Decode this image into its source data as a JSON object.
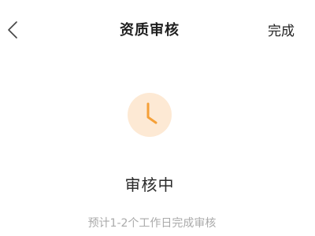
{
  "header": {
    "back_icon": "chevron-left-icon",
    "title": "资质审核",
    "done_label": "完成"
  },
  "status": {
    "icon": "clock-icon",
    "icon_color": "#f5a038",
    "icon_bg_color": "#fde9d4",
    "label": "审核中",
    "hint": "预计1-2个工作日完成审核"
  }
}
